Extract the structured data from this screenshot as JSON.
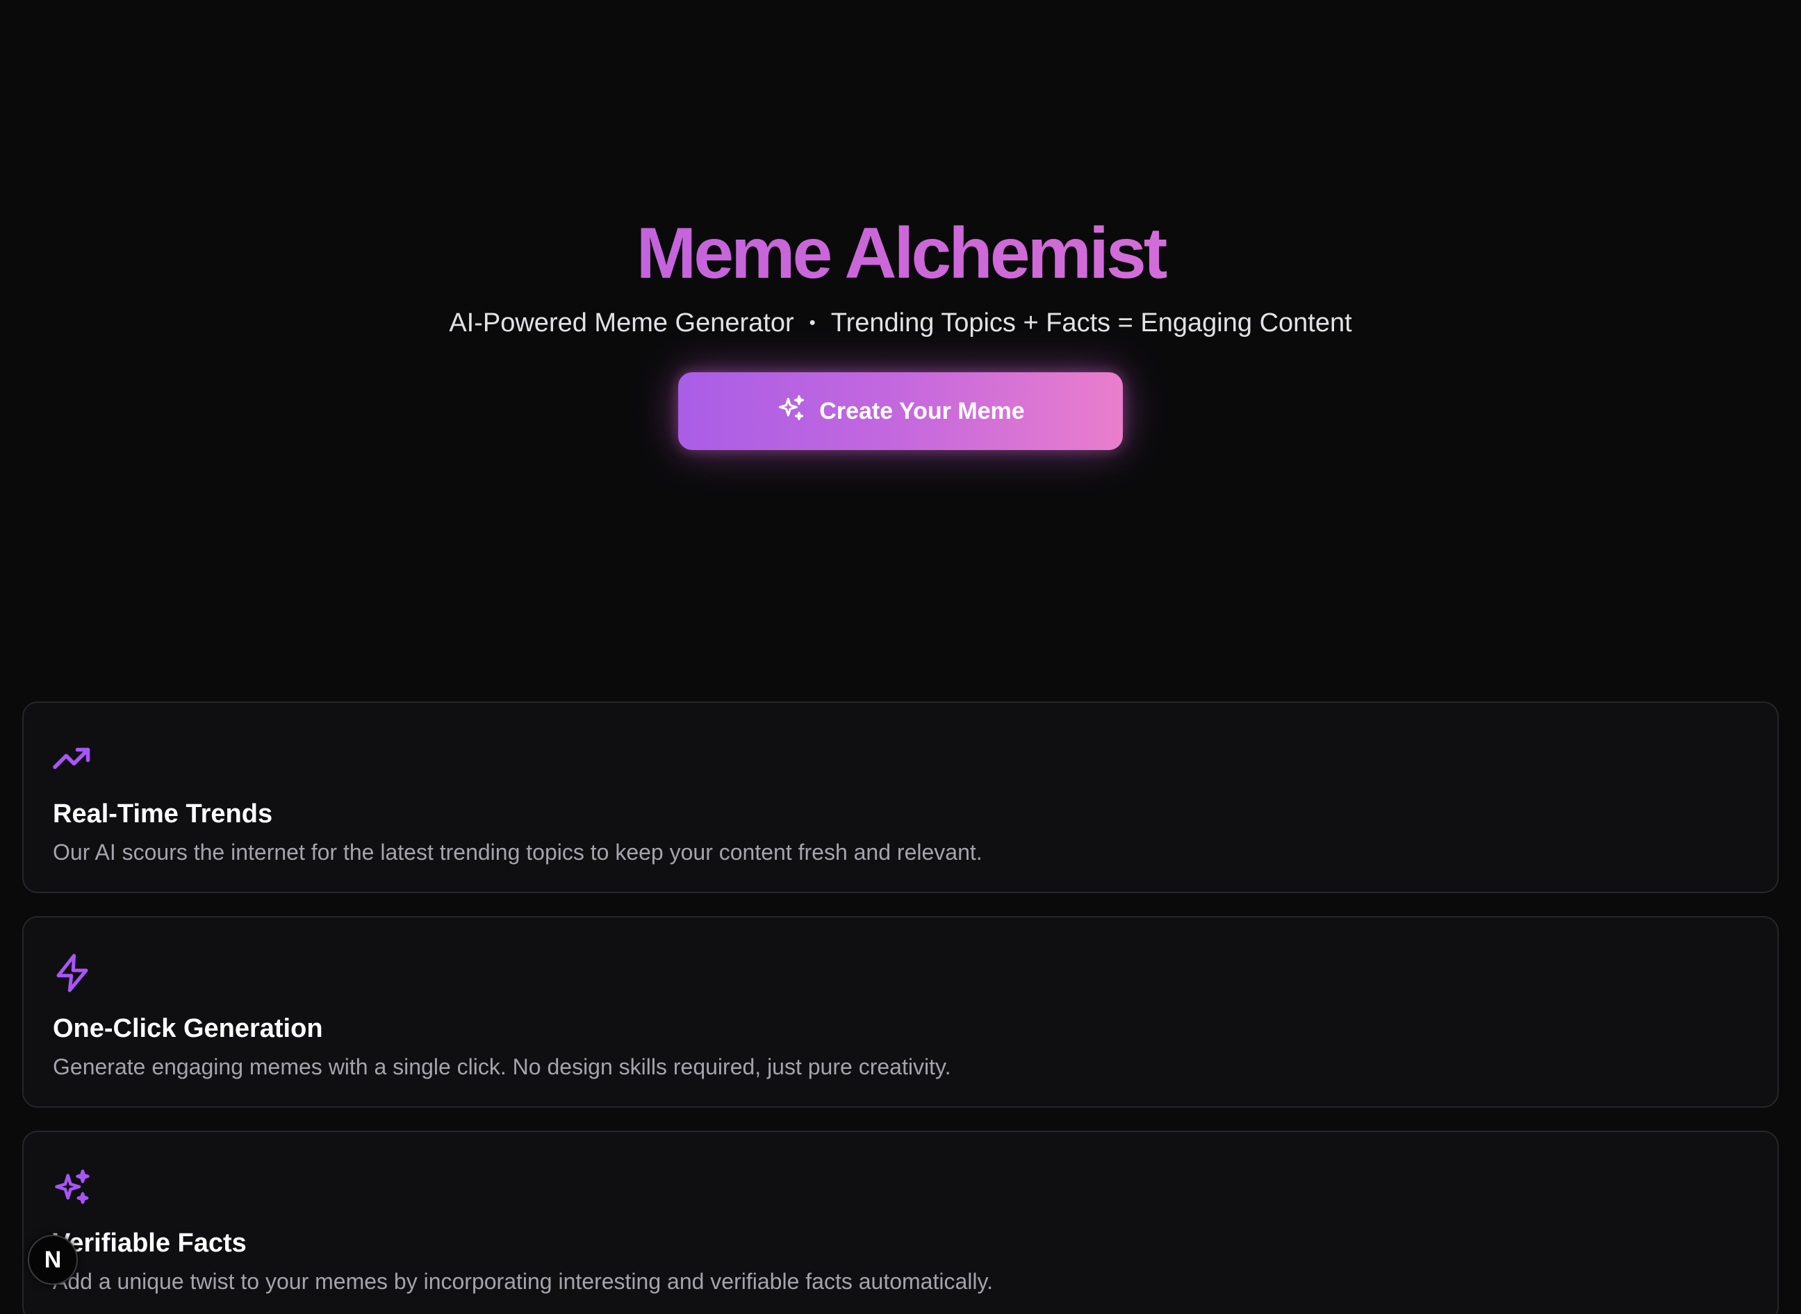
{
  "hero": {
    "title": "Meme Alchemist",
    "subtitle_left": "AI-Powered Meme Generator",
    "subtitle_separator": "•",
    "subtitle_right": "Trending Topics + Facts = Engaging Content",
    "cta_label": "Create Your Meme",
    "cta_icon": "sparkles-icon"
  },
  "features": [
    {
      "icon": "trending-up-icon",
      "title": "Real-Time Trends",
      "description": "Our AI scours the internet for the latest trending topics to keep your content fresh and relevant."
    },
    {
      "icon": "lightning-icon",
      "title": "One-Click Generation",
      "description": "Generate engaging memes with a single click. No design skills required, just pure creativity."
    },
    {
      "icon": "sparkles-icon",
      "title": "Verifiable Facts",
      "description": "Add a unique twist to your memes by incorporating interesting and verifiable facts automatically."
    }
  ],
  "badge": {
    "label": "N"
  },
  "colors": {
    "background": "#0a0a0b",
    "accent": "#a855f7",
    "accent_pink": "#ec7fcc",
    "card_background": "#0f0f11",
    "card_border": "#26262b",
    "muted_text": "#a4a4ac"
  }
}
